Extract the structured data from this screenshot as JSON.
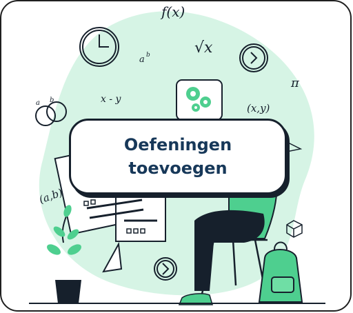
{
  "card": {
    "button_label": "Oefeningen toevoegen"
  },
  "illustration": {
    "formulas": [
      "f(x)",
      "aᵇ",
      "√x",
      "x - y",
      "(x,y)",
      "π",
      "(a,b)",
      "a",
      "b"
    ],
    "icons": [
      "clock-icon",
      "gear-icon",
      "plant-icon",
      "backpack-icon",
      "cube-icon",
      "triangle-icon",
      "chair-icon"
    ],
    "accent_color": "#4ecf8f",
    "blob_color": "#d6f4e5",
    "ink_color": "#16202c"
  }
}
